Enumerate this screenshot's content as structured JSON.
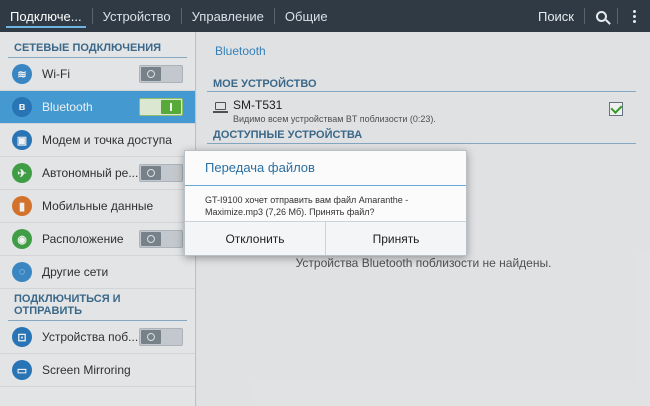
{
  "topbar": {
    "tabs": [
      "Подключе...",
      "Устройство",
      "Управление",
      "Общие"
    ],
    "search_label": "Поиск",
    "icons": {
      "search": "search-icon",
      "menu": "overflow-menu-icon"
    }
  },
  "sidebar": {
    "section1": "СЕТЕВЫЕ ПОДКЛЮЧЕНИЯ",
    "section2": "ПОДКЛЮЧИТЬСЯ И ОТПРАВИТЬ",
    "items": [
      {
        "label": "Wi-Fi",
        "icon": "wifi-icon",
        "toggle": "off"
      },
      {
        "label": "Bluetooth",
        "icon": "bluetooth-icon",
        "toggle": "on",
        "selected": true
      },
      {
        "label": "Модем и точка доступа",
        "icon": "hotspot-icon"
      },
      {
        "label": "Автономный ре...",
        "icon": "airplane-icon",
        "toggle": "off"
      },
      {
        "label": "Мобильные данные",
        "icon": "mobile-data-icon"
      },
      {
        "label": "Расположение",
        "icon": "location-icon",
        "toggle": "off"
      },
      {
        "label": "Другие сети",
        "icon": "other-networks-icon"
      }
    ],
    "items2": [
      {
        "label": "Устройства поб...",
        "icon": "nearby-devices-icon",
        "toggle": "off"
      },
      {
        "label": "Screen Mirroring",
        "icon": "screen-mirroring-icon"
      }
    ]
  },
  "main": {
    "breadcrumb": "Bluetooth",
    "my_device_header": "МОЕ УСТРОЙСТВО",
    "device_name": "SM-T531",
    "device_status": "Видимо всем устройствам BT поблизости (0:23).",
    "available_header": "ДОСТУПНЫЕ УСТРОЙСТВА",
    "empty_note": "Устройства Bluetooth поблизости не найдены."
  },
  "dialog": {
    "title": "Передача файлов",
    "message": "GT-I9100 хочет отправить вам файл Amaranthe - Maximize.mp3 (7,26 Мб). Принять файл?",
    "decline": "Отклонить",
    "accept": "Принять"
  },
  "colors": {
    "topbar": "#2f3a45",
    "accent": "#4aa3df",
    "toggle_on": "#5cb53b",
    "section_header": "#3f6f92"
  }
}
